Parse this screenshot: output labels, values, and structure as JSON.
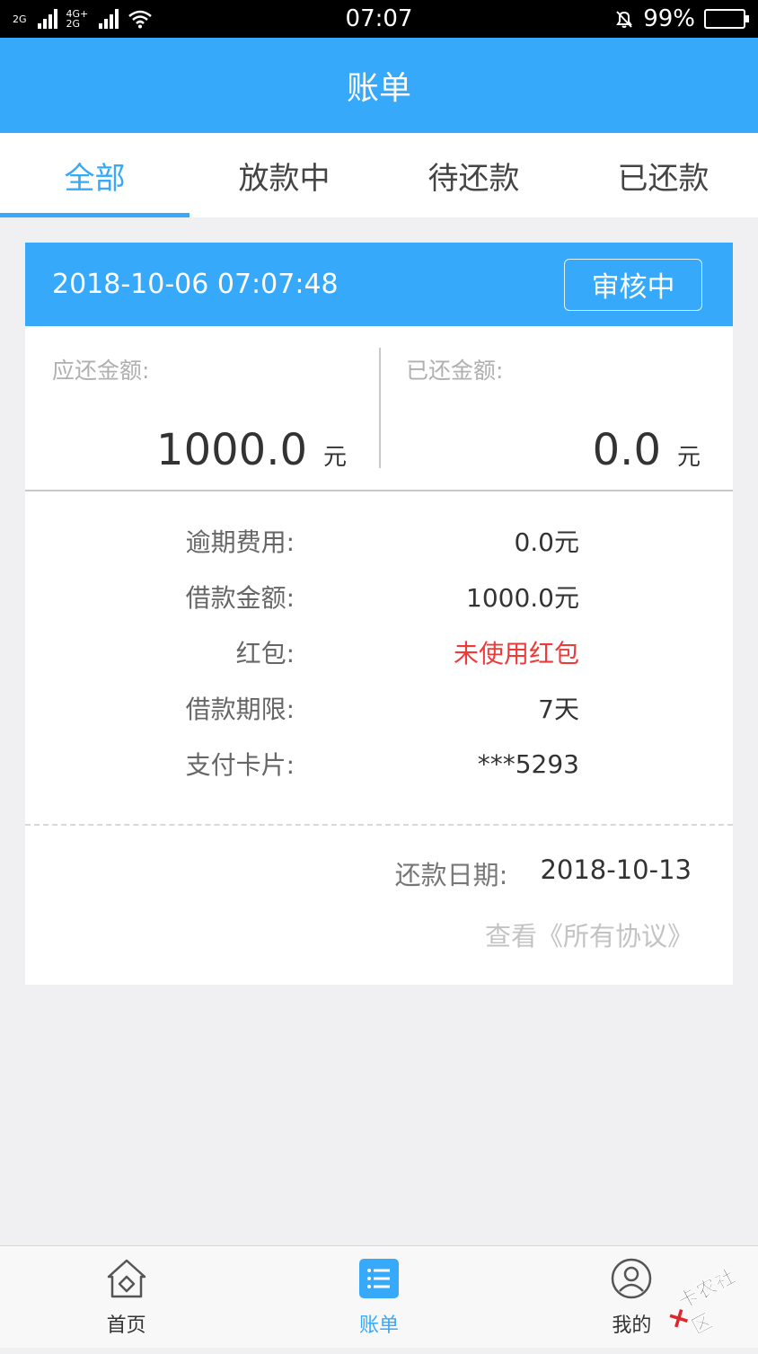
{
  "status_bar": {
    "signal1_label_top": "2G",
    "signal2_label_top": "4G+",
    "signal2_label_bottom": "2G",
    "time": "07:07",
    "battery": "99%",
    "battery_level": 0.99
  },
  "header": {
    "title": "账单"
  },
  "tabs": [
    {
      "label": "全部",
      "active": true
    },
    {
      "label": "放款中",
      "active": false
    },
    {
      "label": "待还款",
      "active": false
    },
    {
      "label": "已还款",
      "active": false
    }
  ],
  "bill": {
    "datetime": "2018-10-06 07:07:48",
    "status": "审核中",
    "due_label": "应还金额:",
    "due_amount": "1000.0",
    "due_unit": "元",
    "paid_label": "已还金额:",
    "paid_amount": "0.0",
    "paid_unit": "元",
    "details": [
      {
        "label": "逾期费用:",
        "value": "0.0元"
      },
      {
        "label": "借款金额:",
        "value": "1000.0元"
      },
      {
        "label": "红包:",
        "value": "未使用红包"
      },
      {
        "label": "借款期限:",
        "value": "7天"
      },
      {
        "label": "支付卡片:",
        "value": "***5293"
      }
    ],
    "repay_date_label": "还款日期:",
    "repay_date": "2018-10-13",
    "agreements_link": "查看《所有协议》"
  },
  "bottom_nav": [
    {
      "label": "首页",
      "icon": "home-icon"
    },
    {
      "label": "账单",
      "icon": "bill-list-icon",
      "active": true
    },
    {
      "label": "我的",
      "icon": "user-icon"
    }
  ],
  "watermark": {
    "text": "卡农社区"
  },
  "colors": {
    "accent": "#36a9fb",
    "warning_red": "#f03a3a",
    "background": "#f0f0f2"
  }
}
